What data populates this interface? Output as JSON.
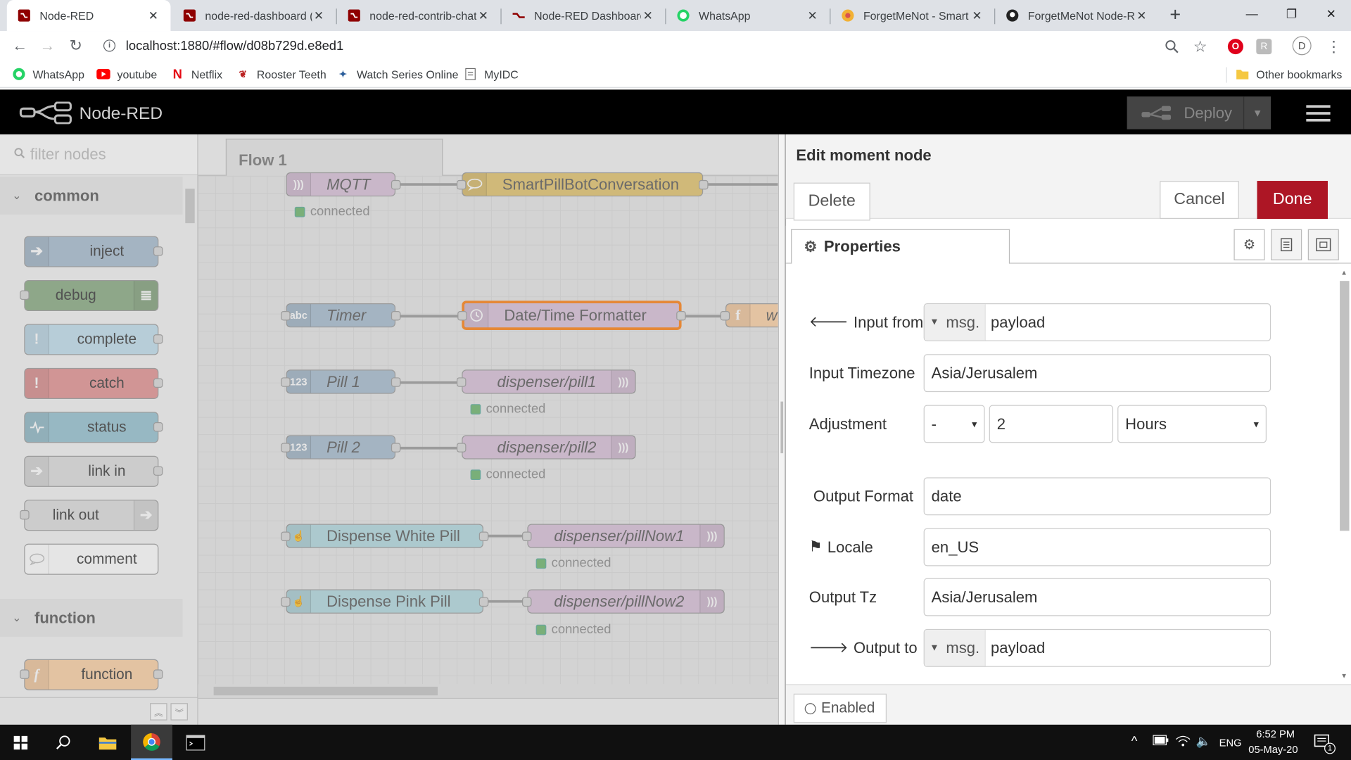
{
  "browser": {
    "tabs": [
      {
        "title": "Node-RED",
        "active": true,
        "icon": "node-red-favicon"
      },
      {
        "title": "node-red-dashboard (r",
        "active": false,
        "icon": "node-red-favicon"
      },
      {
        "title": "node-red-contrib-chatl",
        "active": false,
        "icon": "node-red-favicon"
      },
      {
        "title": "Node-RED Dashboard",
        "active": false,
        "icon": "node-red-dashboard-favicon"
      },
      {
        "title": "WhatsApp",
        "active": false,
        "icon": "whatsapp-icon"
      },
      {
        "title": "ForgetMeNot - Smart I",
        "active": false,
        "icon": "forgetmenot-icon"
      },
      {
        "title": "ForgetMeNot Node-RE",
        "active": false,
        "icon": "github-icon"
      }
    ],
    "url": "localhost:1880/#flow/d08b729d.e8ed1",
    "bookmarks": [
      {
        "label": "WhatsApp",
        "icon": "whatsapp-icon"
      },
      {
        "label": "youtube",
        "icon": "youtube-icon"
      },
      {
        "label": "Netflix",
        "icon": "netflix-icon"
      },
      {
        "label": "Rooster Teeth",
        "icon": "rooster-teeth-icon"
      },
      {
        "label": "Watch Series Online",
        "icon": "watch-series-icon"
      },
      {
        "label": "MyIDC",
        "icon": "page-icon"
      }
    ],
    "other_bookmarks": "Other bookmarks",
    "avatar_letter": "D"
  },
  "nodered": {
    "brand": "Node-RED",
    "deploy_label": "Deploy",
    "palette": {
      "search_placeholder": "filter nodes",
      "categories": [
        "common",
        "function"
      ],
      "nodes": [
        {
          "label": "inject",
          "color": "#a6bbcf"
        },
        {
          "label": "debug",
          "color": "#87a980"
        },
        {
          "label": "complete",
          "color": "#c0deed"
        },
        {
          "label": "catch",
          "color": "#e49191"
        },
        {
          "label": "status",
          "color": "#94c1d0"
        },
        {
          "label": "link in",
          "color": "#dddddd"
        },
        {
          "label": "link out",
          "color": "#dddddd"
        },
        {
          "label": "comment",
          "color": "#ffffff"
        },
        {
          "label": "function",
          "color": "#fdd0a2"
        }
      ]
    },
    "workspace": {
      "flow_tab": "Flow 1",
      "nodes": [
        {
          "label": "MQTT"
        },
        {
          "label": "SmartPillBotConversation"
        },
        {
          "label": "Timer"
        },
        {
          "label": "Date/Time Formatter"
        },
        {
          "label": "w"
        },
        {
          "label": "Pill 1"
        },
        {
          "label": "dispenser/pill1"
        },
        {
          "label": "Pill 2"
        },
        {
          "label": "dispenser/pill2"
        },
        {
          "label": "Dispense White Pill"
        },
        {
          "label": "dispenser/pillNow1"
        },
        {
          "label": "Dispense Pink Pill"
        },
        {
          "label": "dispenser/pillNow2"
        }
      ],
      "status_text": "connected"
    },
    "editor": {
      "title": "Edit moment node",
      "delete_label": "Delete",
      "cancel_label": "Cancel",
      "done_label": "Done",
      "properties_tab": "Properties",
      "fields": {
        "input_from": {
          "label": "Input from",
          "prefix": "msg.",
          "value": "payload"
        },
        "input_timezone": {
          "label": "Input Timezone",
          "value": "Asia/Jerusalem"
        },
        "adjustment": {
          "label": "Adjustment",
          "op": "-",
          "amount": "2",
          "unit": "Hours"
        },
        "output_format": {
          "label": "Output Format",
          "value": "date"
        },
        "locale": {
          "label": "Locale",
          "value": "en_US"
        },
        "output_tz": {
          "label": "Output Tz",
          "value": "Asia/Jerusalem"
        },
        "output_to": {
          "label": "Output to",
          "prefix": "msg.",
          "value": "payload"
        }
      },
      "enabled_label": "Enabled"
    }
  },
  "taskbar": {
    "language": "ENG",
    "time": "6:52 PM",
    "date": "05-May-20",
    "notification_count": "1"
  },
  "colors": {
    "done_button": "#ad1625",
    "header_bg": "#000000",
    "mqtt_node": "#d8bfd8",
    "chatbot_node": "#e2c26a",
    "timer_node": "#a6bbcf"
  }
}
